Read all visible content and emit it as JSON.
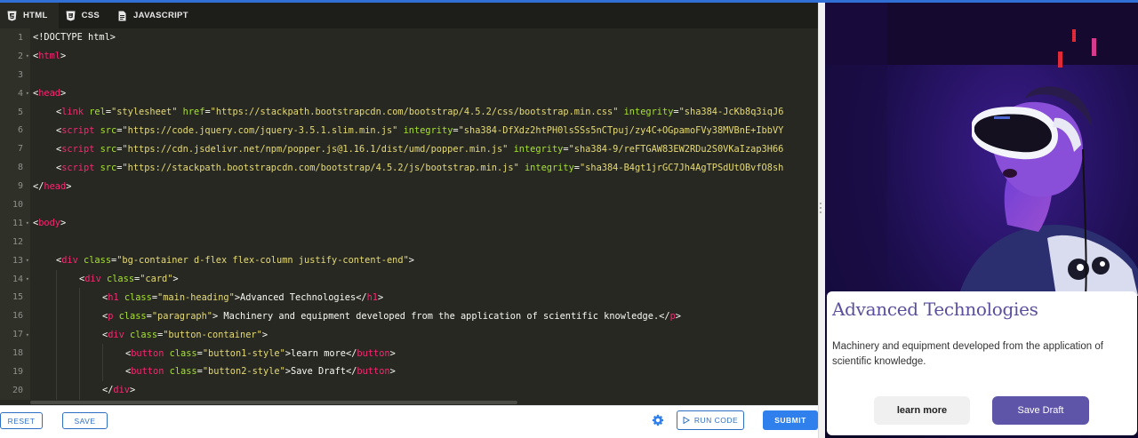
{
  "colors": {
    "editor_bg": "#272822",
    "tag": "#f92672",
    "attr": "#a6e22e",
    "string": "#e6db74",
    "accent": "#2f80ed",
    "heading": "#5a4f9f",
    "button2": "#5e55a8"
  },
  "tabs": [
    {
      "label": "HTML",
      "icon": "html5-icon"
    },
    {
      "label": "CSS",
      "icon": "css3-icon"
    },
    {
      "label": "JAVASCRIPT",
      "icon": "file-icon"
    }
  ],
  "code": {
    "lines": [
      {
        "n": "1",
        "fold": false,
        "indent": 0,
        "parts": [
          {
            "c": "p",
            "t": "<!DOCTYPE html>"
          }
        ]
      },
      {
        "n": "2",
        "fold": true,
        "indent": 0,
        "parts": [
          {
            "c": "p",
            "t": "<"
          },
          {
            "c": "t",
            "t": "html"
          },
          {
            "c": "p",
            "t": ">"
          }
        ]
      },
      {
        "n": "3",
        "fold": false,
        "indent": 0,
        "parts": []
      },
      {
        "n": "4",
        "fold": true,
        "indent": 0,
        "parts": [
          {
            "c": "p",
            "t": "<"
          },
          {
            "c": "t",
            "t": "head"
          },
          {
            "c": "p",
            "t": ">"
          }
        ]
      },
      {
        "n": "5",
        "fold": false,
        "indent": 1,
        "parts": [
          {
            "c": "p",
            "t": "<"
          },
          {
            "c": "t",
            "t": "link"
          },
          {
            "c": "p",
            "t": " "
          },
          {
            "c": "a",
            "t": "rel"
          },
          {
            "c": "p",
            "t": "="
          },
          {
            "c": "s",
            "t": "\"stylesheet\""
          },
          {
            "c": "p",
            "t": " "
          },
          {
            "c": "a",
            "t": "href"
          },
          {
            "c": "p",
            "t": "="
          },
          {
            "c": "s",
            "t": "\"https://stackpath.bootstrapcdn.com/bootstrap/4.5.2/css/bootstrap.min.css\""
          },
          {
            "c": "p",
            "t": " "
          },
          {
            "c": "a",
            "t": "integrity"
          },
          {
            "c": "p",
            "t": "="
          },
          {
            "c": "s",
            "t": "\"sha384-JcKb8q3iqJ6"
          }
        ]
      },
      {
        "n": "6",
        "fold": false,
        "indent": 1,
        "parts": [
          {
            "c": "p",
            "t": "<"
          },
          {
            "c": "t",
            "t": "script"
          },
          {
            "c": "p",
            "t": " "
          },
          {
            "c": "a",
            "t": "src"
          },
          {
            "c": "p",
            "t": "="
          },
          {
            "c": "s",
            "t": "\"https://code.jquery.com/jquery-3.5.1.slim.min.js\""
          },
          {
            "c": "p",
            "t": " "
          },
          {
            "c": "a",
            "t": "integrity"
          },
          {
            "c": "p",
            "t": "="
          },
          {
            "c": "s",
            "t": "\"sha384-DfXdz2htPH0lsSSs5nCTpuj/zy4C+OGpamoFVy38MVBnE+IbbVY"
          }
        ]
      },
      {
        "n": "7",
        "fold": false,
        "indent": 1,
        "parts": [
          {
            "c": "p",
            "t": "<"
          },
          {
            "c": "t",
            "t": "script"
          },
          {
            "c": "p",
            "t": " "
          },
          {
            "c": "a",
            "t": "src"
          },
          {
            "c": "p",
            "t": "="
          },
          {
            "c": "s",
            "t": "\"https://cdn.jsdelivr.net/npm/popper.js@1.16.1/dist/umd/popper.min.js\""
          },
          {
            "c": "p",
            "t": " "
          },
          {
            "c": "a",
            "t": "integrity"
          },
          {
            "c": "p",
            "t": "="
          },
          {
            "c": "s",
            "t": "\"sha384-9/reFTGAW83EW2RDu2S0VKaIzap3H66"
          }
        ]
      },
      {
        "n": "8",
        "fold": false,
        "indent": 1,
        "parts": [
          {
            "c": "p",
            "t": "<"
          },
          {
            "c": "t",
            "t": "script"
          },
          {
            "c": "p",
            "t": " "
          },
          {
            "c": "a",
            "t": "src"
          },
          {
            "c": "p",
            "t": "="
          },
          {
            "c": "s",
            "t": "\"https://stackpath.bootstrapcdn.com/bootstrap/4.5.2/js/bootstrap.min.js\""
          },
          {
            "c": "p",
            "t": " "
          },
          {
            "c": "a",
            "t": "integrity"
          },
          {
            "c": "p",
            "t": "="
          },
          {
            "c": "s",
            "t": "\"sha384-B4gt1jrGC7Jh4AgTPSdUtOBvfO8sh"
          }
        ]
      },
      {
        "n": "9",
        "fold": false,
        "indent": 0,
        "parts": [
          {
            "c": "p",
            "t": "</"
          },
          {
            "c": "t",
            "t": "head"
          },
          {
            "c": "p",
            "t": ">"
          }
        ]
      },
      {
        "n": "10",
        "fold": false,
        "indent": 0,
        "parts": []
      },
      {
        "n": "11",
        "fold": true,
        "indent": 0,
        "parts": [
          {
            "c": "p",
            "t": "<"
          },
          {
            "c": "t",
            "t": "body"
          },
          {
            "c": "p",
            "t": ">"
          }
        ]
      },
      {
        "n": "12",
        "fold": false,
        "indent": 0,
        "parts": []
      },
      {
        "n": "13",
        "fold": true,
        "indent": 1,
        "parts": [
          {
            "c": "p",
            "t": "<"
          },
          {
            "c": "t",
            "t": "div"
          },
          {
            "c": "p",
            "t": " "
          },
          {
            "c": "a",
            "t": "class"
          },
          {
            "c": "p",
            "t": "="
          },
          {
            "c": "s",
            "t": "\"bg-container d-flex flex-column justify-content-end\""
          },
          {
            "c": "p",
            "t": ">"
          }
        ]
      },
      {
        "n": "14",
        "fold": true,
        "indent": 2,
        "parts": [
          {
            "c": "p",
            "t": "<"
          },
          {
            "c": "t",
            "t": "div"
          },
          {
            "c": "p",
            "t": " "
          },
          {
            "c": "a",
            "t": "class"
          },
          {
            "c": "p",
            "t": "="
          },
          {
            "c": "s",
            "t": "\"card\""
          },
          {
            "c": "p",
            "t": ">"
          }
        ]
      },
      {
        "n": "15",
        "fold": false,
        "indent": 3,
        "parts": [
          {
            "c": "p",
            "t": "<"
          },
          {
            "c": "t",
            "t": "h1"
          },
          {
            "c": "p",
            "t": " "
          },
          {
            "c": "a",
            "t": "class"
          },
          {
            "c": "p",
            "t": "="
          },
          {
            "c": "s",
            "t": "\"main-heading\""
          },
          {
            "c": "p",
            "t": ">Advanced Technologies</"
          },
          {
            "c": "t",
            "t": "h1"
          },
          {
            "c": "p",
            "t": ">"
          }
        ]
      },
      {
        "n": "16",
        "fold": false,
        "indent": 3,
        "parts": [
          {
            "c": "p",
            "t": "<"
          },
          {
            "c": "t",
            "t": "p"
          },
          {
            "c": "p",
            "t": " "
          },
          {
            "c": "a",
            "t": "class"
          },
          {
            "c": "p",
            "t": "="
          },
          {
            "c": "s",
            "t": "\"paragraph\""
          },
          {
            "c": "p",
            "t": "> Machinery and equipment developed from the application of scientific knowledge.</"
          },
          {
            "c": "t",
            "t": "p"
          },
          {
            "c": "p",
            "t": ">"
          }
        ]
      },
      {
        "n": "17",
        "fold": true,
        "indent": 3,
        "parts": [
          {
            "c": "p",
            "t": "<"
          },
          {
            "c": "t",
            "t": "div"
          },
          {
            "c": "p",
            "t": " "
          },
          {
            "c": "a",
            "t": "class"
          },
          {
            "c": "p",
            "t": "="
          },
          {
            "c": "s",
            "t": "\"button-container\""
          },
          {
            "c": "p",
            "t": ">"
          }
        ]
      },
      {
        "n": "18",
        "fold": false,
        "indent": 4,
        "parts": [
          {
            "c": "p",
            "t": "<"
          },
          {
            "c": "t",
            "t": "button"
          },
          {
            "c": "p",
            "t": " "
          },
          {
            "c": "a",
            "t": "class"
          },
          {
            "c": "p",
            "t": "="
          },
          {
            "c": "s",
            "t": "\"button1-style\""
          },
          {
            "c": "p",
            "t": ">learn more</"
          },
          {
            "c": "t",
            "t": "button"
          },
          {
            "c": "p",
            "t": ">"
          }
        ]
      },
      {
        "n": "19",
        "fold": false,
        "indent": 4,
        "parts": [
          {
            "c": "p",
            "t": "<"
          },
          {
            "c": "t",
            "t": "button"
          },
          {
            "c": "p",
            "t": " "
          },
          {
            "c": "a",
            "t": "class"
          },
          {
            "c": "p",
            "t": "="
          },
          {
            "c": "s",
            "t": "\"button2-style\""
          },
          {
            "c": "p",
            "t": ">Save Draft</"
          },
          {
            "c": "t",
            "t": "button"
          },
          {
            "c": "p",
            "t": ">"
          }
        ]
      },
      {
        "n": "20",
        "fold": false,
        "indent": 3,
        "parts": [
          {
            "c": "p",
            "t": "</"
          },
          {
            "c": "t",
            "t": "div"
          },
          {
            "c": "p",
            "t": ">"
          }
        ]
      }
    ]
  },
  "toolbar": {
    "reset_label": "RESET",
    "save_label": "SAVE",
    "settings_icon": "gear-icon",
    "run_label": "RUN CODE",
    "run_icon": "play-icon",
    "submit_label": "SUBMIT"
  },
  "preview": {
    "heading": "Advanced Technologies",
    "paragraph": "Machinery and equipment developed from the application of scientific knowledge.",
    "button1": "learn more",
    "button2": "Save Draft",
    "image": "person-wearing-vr-headset-photo"
  }
}
